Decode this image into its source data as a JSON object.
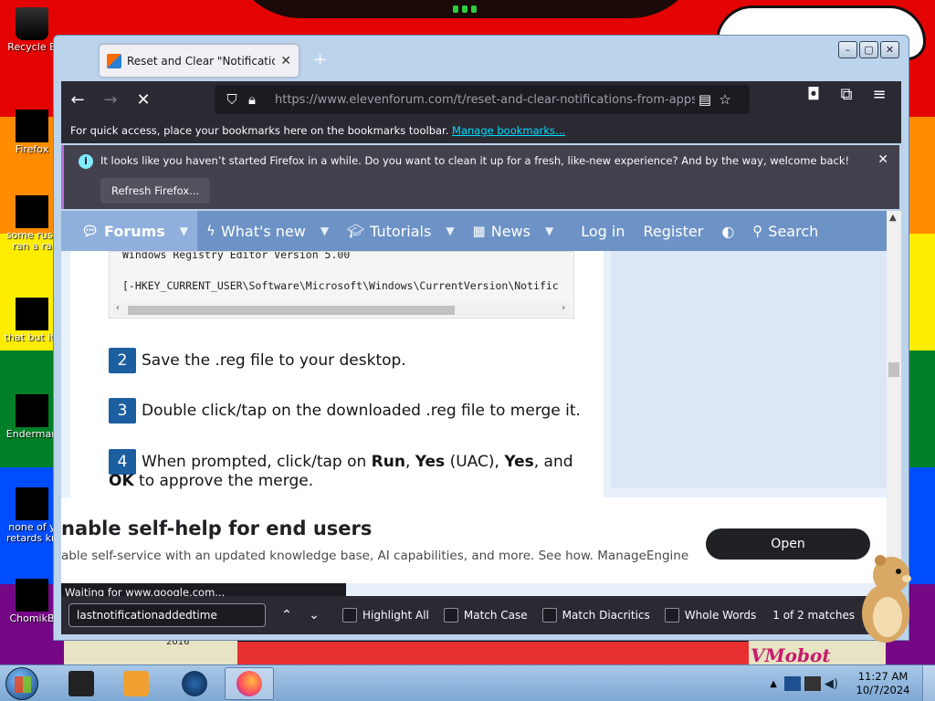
{
  "desktop": {
    "icons": [
      {
        "label": "Recycle B",
        "icon": "recycle-bin-icon"
      },
      {
        "label": "Firefox",
        "icon": "firefox-icon"
      },
      {
        "label": "some russ\nran a ra",
        "icon": "file-icon"
      },
      {
        "label": "that but its",
        "icon": "file-icon"
      },
      {
        "label": "Enderman",
        "icon": "file-icon"
      },
      {
        "label": "none of y\nretards kn",
        "icon": "file-icon"
      },
      {
        "label": "ChomikB",
        "icon": "file-icon"
      }
    ],
    "wallpaper_text": "VMobot",
    "wallpaper_year": "2016"
  },
  "browser": {
    "tab_title": "Reset and Clear \"Notifications f",
    "url": "https://www.elevenforum.com/t/reset-and-clear-notifications-from-apps-and",
    "bookmarks_text": "For quick access, place your bookmarks here on the bookmarks toolbar.",
    "bookmarks_link": "Manage bookmarks...",
    "notification": {
      "message": "It looks like you haven’t started Firefox in a while. Do you want to clean it up for a fresh, like-new experience? And by the way, welcome back!",
      "button": "Refresh Firefox..."
    },
    "status": "Waiting for www.google.com...",
    "find": {
      "value": "lastnotificationaddedtime",
      "highlight_all": "Highlight All",
      "match_case": "Match Case",
      "match_diacritics": "Match Diacritics",
      "whole_words": "Whole Words",
      "matches": "1 of 2 matches"
    }
  },
  "forum": {
    "nav": {
      "forums": "Forums",
      "whats_new": "What's new",
      "tutorials": "Tutorials",
      "news": "News",
      "login": "Log in",
      "register": "Register",
      "search": "Search"
    },
    "code_line1": "Windows Registry Editor Version 5.00",
    "code_line2": "[-HKEY_CURRENT_USER\\Software\\Microsoft\\Windows\\CurrentVersion\\Notific",
    "steps": [
      {
        "num": "2",
        "text": "Save the .reg file to your desktop."
      },
      {
        "num": "3",
        "text": "Double click/tap on the downloaded .reg file to merge it."
      },
      {
        "num": "4",
        "pre": "When prompted, click/tap on ",
        "run": "Run",
        "yes": "Yes",
        "uac": "UAC",
        "yes2": "Yes",
        "and": ", and",
        "ok": "OK",
        "rest": " to approve the merge."
      }
    ]
  },
  "ad": {
    "headline": "nable self-help for end users",
    "subtext": "able self-service with an updated knowledge base, AI capabilities, and more. See how. ManageEngine",
    "button": "Open"
  },
  "taskbar": {
    "time": "11:27 AM",
    "date": "10/7/2024"
  }
}
